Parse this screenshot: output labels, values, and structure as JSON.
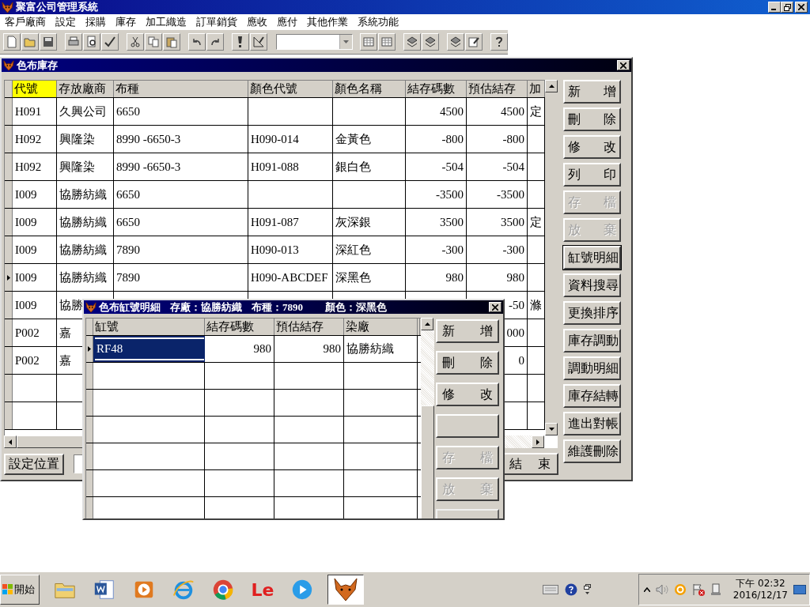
{
  "app": {
    "title": "聚富公司管理系統"
  },
  "menu": [
    "客戶廠商",
    "設定",
    "採購",
    "庫存",
    "加工織造",
    "訂單銷貨",
    "應收",
    "應付",
    "其他作業",
    "系統功能"
  ],
  "main_window": {
    "title": "色布庫存",
    "columns": [
      {
        "label": "代號",
        "sorted": true
      },
      {
        "label": "存放廠商",
        "sorted": false
      },
      {
        "label": "布種",
        "sorted": false
      },
      {
        "label": "顏色代號",
        "sorted": false
      },
      {
        "label": "顏色名稱",
        "sorted": false
      },
      {
        "label": "結存碼數",
        "sorted": false
      },
      {
        "label": "預估結存",
        "sorted": false
      },
      {
        "label": "加",
        "sorted": false
      }
    ],
    "rows": [
      {
        "selected": false,
        "cells": {
          "code": "H091",
          "vendor": "久興公司",
          "fabric": "6650",
          "stock_yards": "4500",
          "est_stock": "4500",
          "column_8": "定"
        }
      },
      {
        "selected": false,
        "cells": {
          "code": "H092",
          "vendor": "興隆染",
          "fabric": "8990 -6650-3",
          "color_code": "H090-014",
          "color_name": "金黃色",
          "stock_yards": "-800",
          "est_stock": "-800"
        }
      },
      {
        "selected": false,
        "cells": {
          "code": "H092",
          "vendor": "興隆染",
          "fabric": "8990 -6650-3",
          "color_code": "H091-088",
          "color_name": "銀白色",
          "stock_yards": "-504",
          "est_stock": "-504"
        }
      },
      {
        "selected": false,
        "cells": {
          "code": "I009",
          "vendor": "協勝紡織",
          "fabric": "6650",
          "stock_yards": "-3500",
          "est_stock": "-3500"
        }
      },
      {
        "selected": false,
        "cells": {
          "code": "I009",
          "vendor": "協勝紡織",
          "fabric": "6650",
          "color_code": "H091-087",
          "color_name": "灰深銀",
          "stock_yards": "3500",
          "est_stock": "3500",
          "column_8": "定"
        }
      },
      {
        "selected": false,
        "cells": {
          "code": "I009",
          "vendor": "協勝紡織",
          "fabric": "7890",
          "color_code": "H090-013",
          "color_name": "深紅色",
          "stock_yards": "-300",
          "est_stock": "-300"
        }
      },
      {
        "selected": true,
        "cells": {
          "code": "I009",
          "vendor": "協勝紡織",
          "fabric": "7890",
          "color_code": "H090-ABCDEF",
          "color_name": "深黑色",
          "stock_yards": "980",
          "est_stock": "980"
        }
      },
      {
        "selected": false,
        "cells": {
          "code": "I009",
          "vendor": "協勝",
          "est_stock": "-50",
          "column_8": "滌"
        }
      },
      {
        "selected": false,
        "cells": {
          "code": "P002",
          "vendor": "嘉",
          "est_stock": "000"
        }
      },
      {
        "selected": false,
        "cells": {
          "code": "P002",
          "vendor": "嘉",
          "est_stock": "0"
        }
      }
    ],
    "side_buttons": [
      {
        "label": "新 增",
        "disabled": false,
        "focused": false
      },
      {
        "label": "刪 除",
        "disabled": false,
        "focused": false
      },
      {
        "label": "修 改",
        "disabled": false,
        "focused": false
      },
      {
        "label": "列 印",
        "disabled": false,
        "focused": false
      },
      {
        "label": "存 檔",
        "disabled": true,
        "focused": false
      },
      {
        "label": "放 棄",
        "disabled": true,
        "focused": false
      },
      {
        "label": "缸號明細",
        "disabled": false,
        "focused": true
      },
      {
        "label": "資料搜尋",
        "disabled": false,
        "focused": false
      },
      {
        "label": "更換排序",
        "disabled": false,
        "focused": false
      },
      {
        "label": "庫存調動",
        "disabled": false,
        "focused": false
      },
      {
        "label": "調動明細",
        "disabled": false,
        "focused": false
      },
      {
        "label": "庫存結轉",
        "disabled": false,
        "focused": false
      },
      {
        "label": "進出對帳",
        "disabled": false,
        "focused": false
      },
      {
        "label": "維護刪除",
        "disabled": false,
        "focused": false
      }
    ],
    "position_button": "設定位置",
    "exit_button": "結 束"
  },
  "dialog": {
    "title": "色布缸號明細",
    "fields": [
      "存廠：協勝紡織",
      "布種：7890",
      "顏色：深黑色"
    ],
    "columns": [
      "缸號",
      "結存碼數",
      "預估結存",
      "染廠"
    ],
    "rows": [
      {
        "selected": true,
        "cells": {
          "vat_no": "RF48",
          "stock_yards": "980",
          "est_stock": "980",
          "dyer": "協勝紡織"
        }
      }
    ],
    "buttons": [
      {
        "kind": "text",
        "label": "新 增",
        "disabled": false
      },
      {
        "kind": "text",
        "label": "刪 除",
        "disabled": false
      },
      {
        "kind": "text",
        "label": "修 改",
        "disabled": false
      },
      {
        "kind": "blank",
        "disabled": false
      },
      {
        "kind": "text",
        "label": "存 檔",
        "disabled": true
      },
      {
        "kind": "text",
        "label": "放 棄",
        "disabled": true
      },
      {
        "kind": "blank",
        "disabled": true
      }
    ]
  },
  "taskbar": {
    "start": "開始",
    "apps": [
      {
        "kind": "folder",
        "selected": false
      },
      {
        "kind": "word",
        "selected": false
      },
      {
        "kind": "player",
        "selected": false
      },
      {
        "kind": "browser-e",
        "selected": false
      },
      {
        "kind": "browser-ring",
        "selected": false
      },
      {
        "kind": "letters",
        "label": "Le",
        "selected": false
      },
      {
        "kind": "play",
        "selected": false
      },
      {
        "kind": "fox",
        "selected": true
      }
    ],
    "time": "下午 02:32",
    "date": "2016/12/17"
  }
}
